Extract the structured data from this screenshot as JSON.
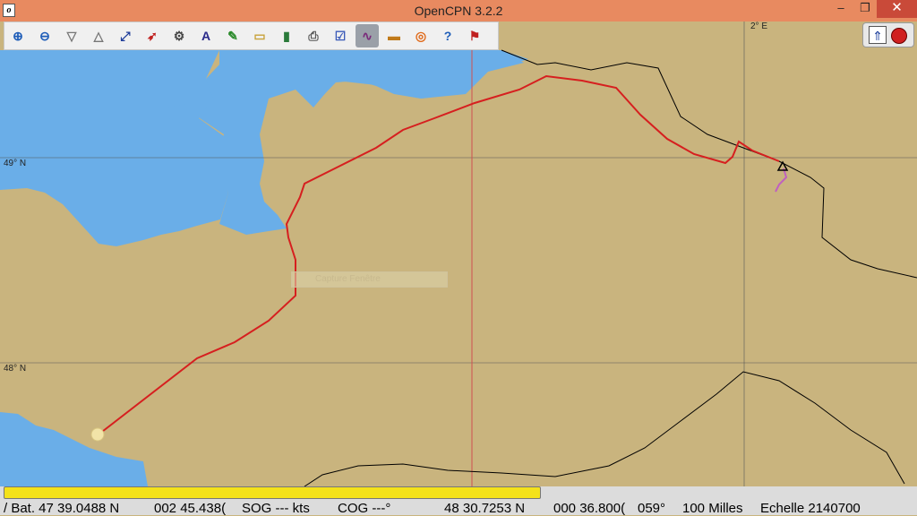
{
  "window": {
    "title": "OpenCPN 3.2.2",
    "icon": "opencpn-app-icon",
    "minimize": "–",
    "maximize": "❐",
    "close": "✕"
  },
  "toolbar": {
    "items": [
      {
        "name": "zoom-in-icon",
        "glyph": "⊕"
      },
      {
        "name": "zoom-out-icon",
        "glyph": "⊖"
      },
      {
        "name": "scale-down-icon",
        "glyph": "▽"
      },
      {
        "name": "scale-up-icon",
        "glyph": "△"
      },
      {
        "name": "route-icon",
        "glyph": "⤢"
      },
      {
        "name": "follow-ship-icon",
        "glyph": "➶"
      },
      {
        "name": "settings-icon",
        "glyph": "⚙"
      },
      {
        "name": "text-icon",
        "glyph": "A"
      },
      {
        "name": "current-icon",
        "glyph": "✎"
      },
      {
        "name": "tide-icon",
        "glyph": "▭"
      },
      {
        "name": "route-manager-icon",
        "glyph": "▮"
      },
      {
        "name": "print-icon",
        "glyph": "⎙"
      },
      {
        "name": "chart-quilt-icon",
        "glyph": "☑"
      },
      {
        "name": "track-icon",
        "glyph": "∿"
      },
      {
        "name": "color-scheme-icon",
        "glyph": "▬"
      },
      {
        "name": "mob-icon",
        "glyph": "◎"
      },
      {
        "name": "help-icon",
        "glyph": "?"
      },
      {
        "name": "ais-icon",
        "glyph": "⚑"
      }
    ],
    "active_index": 13
  },
  "map": {
    "latitude_labels": [
      "49° N",
      "48° N"
    ],
    "longitude_label": "2° E",
    "capture_hint": "Capture Fenêtre"
  },
  "status": {
    "progress": 0.59,
    "bat": "/ Bat. 47 39.0488 N",
    "lon1": "002 45.438(",
    "sog": "SOG --- kts",
    "cog": "COG ---°",
    "lat2": "48 30.7253 N",
    "lon2": "000 36.800(",
    "heading": "059°",
    "distance": "100 Milles",
    "scale": "Echelle 2140700"
  },
  "colors": {
    "land": "#c9b47e",
    "water": "#6aaee8",
    "route": "#d61f1f",
    "track": "#c060c0"
  }
}
